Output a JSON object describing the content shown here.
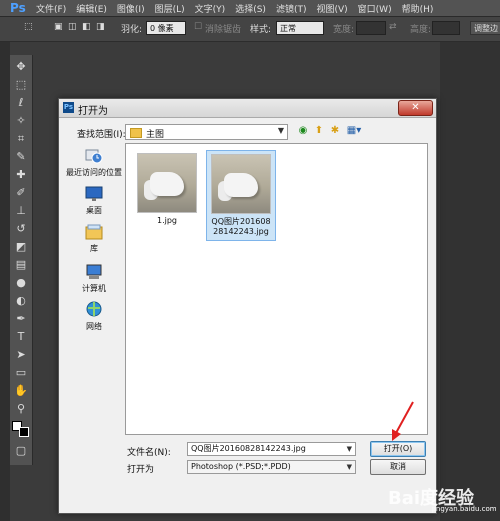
{
  "app": {
    "logo": "Ps"
  },
  "menu": [
    "文件(F)",
    "编辑(E)",
    "图像(I)",
    "图层(L)",
    "文字(Y)",
    "选择(S)",
    "滤镜(T)",
    "视图(V)",
    "窗口(W)",
    "帮助(H)"
  ],
  "options": {
    "feather_label": "羽化:",
    "feather_value": "0 像素",
    "antialias_label": "消除锯齿",
    "style_label": "样式:",
    "style_value": "正常",
    "width_label": "宽度:",
    "height_label": "高度:",
    "refine_label": "调整边"
  },
  "dialog": {
    "title": "打开为",
    "close": "✕",
    "look_in_label": "查找范围(I):",
    "look_in_value": "主图",
    "places": [
      {
        "label": "最近访问的位置"
      },
      {
        "label": "桌面"
      },
      {
        "label": "库"
      },
      {
        "label": "计算机"
      },
      {
        "label": "网络"
      }
    ],
    "files": [
      {
        "name": "1.jpg"
      },
      {
        "name": "QQ图片20160828142243.jpg"
      }
    ],
    "filename_label": "文件名(N):",
    "filename_value": "QQ图片20160828142243.jpg",
    "open_as_label": "打开为",
    "open_as_value": "Photoshop (*.PSD;*.PDD)",
    "open_button": "打开(O)",
    "cancel_button": "取消"
  },
  "watermark": {
    "text": "Bai度经验",
    "sub": "jingyan.baidu.com"
  },
  "colors": {
    "accent": "#4ea0ff",
    "close": "#c0392b",
    "arrow": "#e02020"
  }
}
